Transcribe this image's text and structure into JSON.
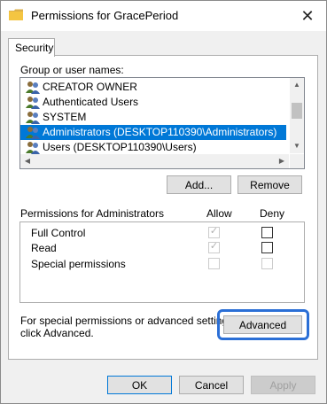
{
  "window": {
    "title": "Permissions for GracePeriod",
    "close_glyph": "✕",
    "folder_icon_color": "#f4c542"
  },
  "tab": {
    "label": "Security"
  },
  "group_label": "Group or user names:",
  "users": [
    {
      "name": "CREATOR OWNER",
      "selected": false
    },
    {
      "name": "Authenticated Users",
      "selected": false
    },
    {
      "name": "SYSTEM",
      "selected": false
    },
    {
      "name": "Administrators (DESKTOP110390\\Administrators)",
      "selected": true
    },
    {
      "name": "Users (DESKTOP110390\\Users)",
      "selected": false
    }
  ],
  "buttons": {
    "add": "Add...",
    "remove": "Remove",
    "advanced": "Advanced",
    "ok": "OK",
    "cancel": "Cancel",
    "apply": "Apply"
  },
  "permissions": {
    "heading": "Permissions for Administrators",
    "allow_header": "Allow",
    "deny_header": "Deny",
    "rows": [
      {
        "label": "Full Control",
        "allow": true,
        "deny": false
      },
      {
        "label": "Read",
        "allow": true,
        "deny": false
      },
      {
        "label": "Special permissions",
        "allow": false,
        "deny": false
      }
    ]
  },
  "advanced_hint_line1": "For special permissions or advanced settings,",
  "advanced_hint_line2": "click Advanced.",
  "colors": {
    "selection": "#0078d7",
    "highlight_ring": "#2b6fd6"
  }
}
